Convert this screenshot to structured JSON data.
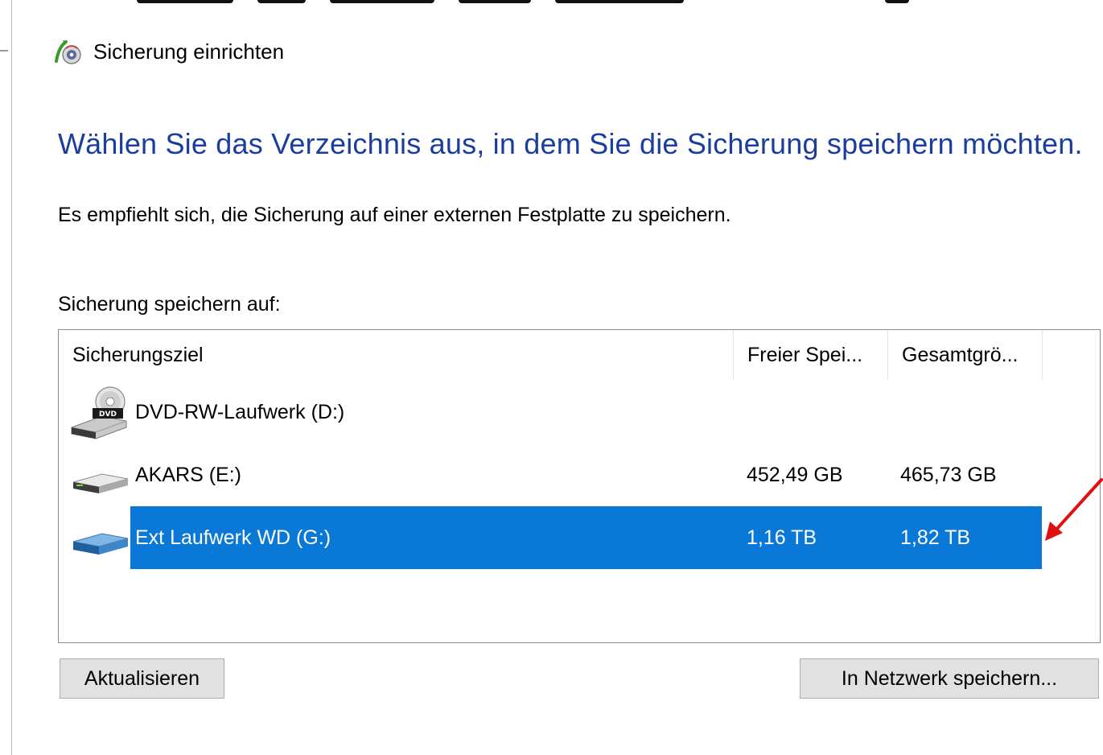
{
  "window": {
    "title": "Sicherung einrichten",
    "icon": "backup-app-icon"
  },
  "heading": "Wählen Sie das Verzeichnis aus, in dem Sie die Sicherung speichern möchten.",
  "recommendation": "Es empfiehlt sich, die Sicherung auf einer externen Festplatte zu speichern.",
  "save_to_label": "Sicherung speichern auf:",
  "columns": {
    "target": "Sicherungsziel",
    "free": "Freier Spei...",
    "total": "Gesamtgrö..."
  },
  "drives": [
    {
      "name": "DVD-RW-Laufwerk (D:)",
      "free": "",
      "total": "",
      "icon": "dvd-drive-icon",
      "selected": false
    },
    {
      "name": "AKARS (E:)",
      "free": "452,49 GB",
      "total": "465,73 GB",
      "icon": "hard-drive-icon",
      "selected": false
    },
    {
      "name": "Ext Laufwerk WD (G:)",
      "free": "1,16 TB",
      "total": "1,82 TB",
      "icon": "external-drive-icon",
      "selected": true
    }
  ],
  "buttons": {
    "refresh": "Aktualisieren",
    "network": "In Netzwerk speichern..."
  },
  "colors": {
    "heading": "#1a3e9e",
    "selection": "#0a78d7",
    "button_bg": "#e1e1e1",
    "annotation_arrow": "#e01010"
  }
}
